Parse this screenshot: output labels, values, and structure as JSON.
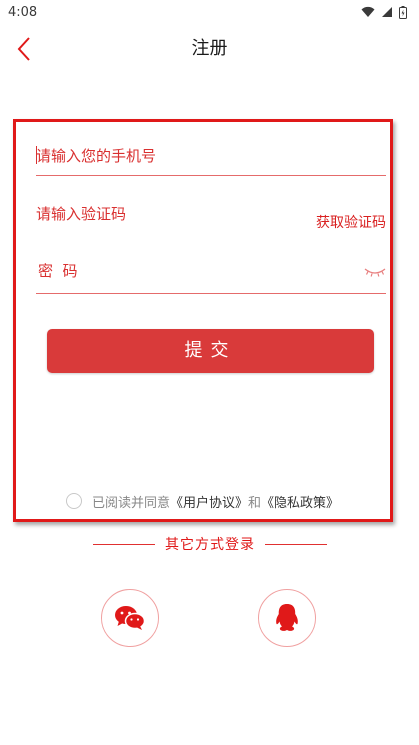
{
  "status_bar": {
    "time": "4:08"
  },
  "header": {
    "title": "注册"
  },
  "form": {
    "phone_placeholder": "请输入您的手机号",
    "code_placeholder": "请输入验证码",
    "get_code_label": "获取验证码",
    "password_placeholder": "密  码",
    "submit_label": "提交"
  },
  "agreement": {
    "prefix": "已阅读并同意",
    "user_agreement": "《用户协议》",
    "and": "和",
    "privacy_policy": "《隐私政策》"
  },
  "other_login": {
    "label": "其它方式登录",
    "options": [
      "wechat-icon",
      "qq-icon"
    ]
  },
  "colors": {
    "accent": "#d93a3a",
    "border": "#e01919"
  }
}
